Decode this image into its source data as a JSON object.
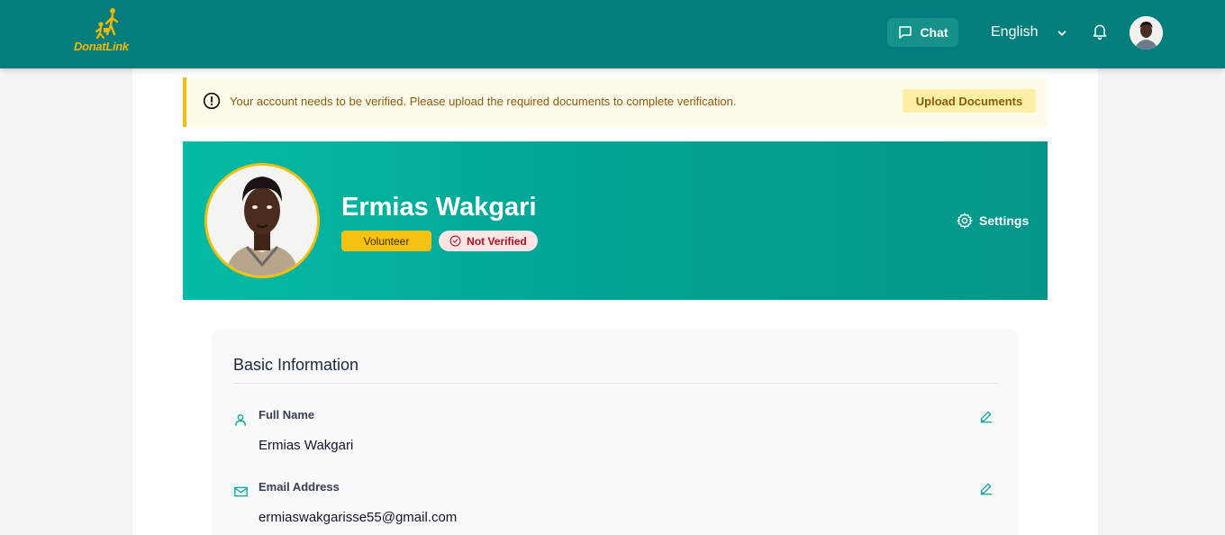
{
  "brand": {
    "name": "DonatLink",
    "accent": "#047d7d",
    "yellow": "#f2c00c"
  },
  "nav": {
    "chat_label": "Chat",
    "language": "English"
  },
  "banner": {
    "message": "Your account needs to be verified. Please upload the required documents to complete verification.",
    "button_label": "Upload Documents"
  },
  "profile": {
    "name": "Ermias Wakgari",
    "role_badge": "Volunteer",
    "status_badge": "Not Verified",
    "settings_label": "Settings"
  },
  "basic_info": {
    "title": "Basic Information",
    "fields": [
      {
        "label": "Full Name",
        "value": "Ermias Wakgari",
        "icon": "user-icon"
      },
      {
        "label": "Email Address",
        "value": "ermiaswakgarisse55@gmail.com",
        "icon": "mail-icon"
      }
    ]
  }
}
